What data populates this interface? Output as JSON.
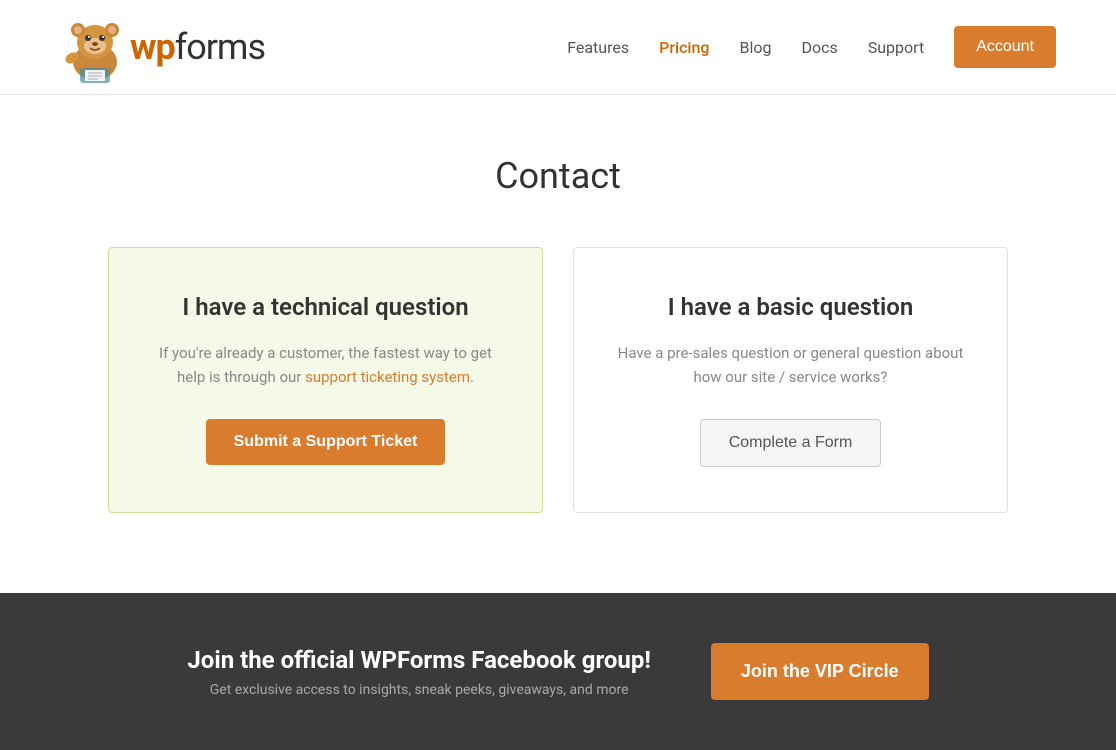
{
  "header": {
    "logo_text_wp": "wp",
    "logo_text_forms": "forms",
    "nav": {
      "features": "Features",
      "pricing": "Pricing",
      "blog": "Blog",
      "docs": "Docs",
      "support": "Support",
      "account": "Account"
    }
  },
  "main": {
    "page_title": "Contact",
    "card_technical": {
      "title": "I have a technical question",
      "description_part1": "If you're already a customer, the fastest way to get help is through our",
      "link_text": "support ticketing system",
      "description_part2": ".",
      "button_label": "Submit a Support Ticket"
    },
    "card_basic": {
      "title": "I have a basic question",
      "description": "Have a pre-sales question or general question about how our site / service works?",
      "button_label": "Complete a Form"
    }
  },
  "footer_cta": {
    "title": "Join the official WPForms Facebook group!",
    "subtitle": "Get exclusive access to insights, sneak peeks, giveaways, and more",
    "button_label": "Join the VIP Circle"
  },
  "colors": {
    "accent_orange": "#d97c2e",
    "header_bg": "#ffffff",
    "dark_footer": "#3a3a3a",
    "card_highlight_bg": "#f5f9e8"
  }
}
